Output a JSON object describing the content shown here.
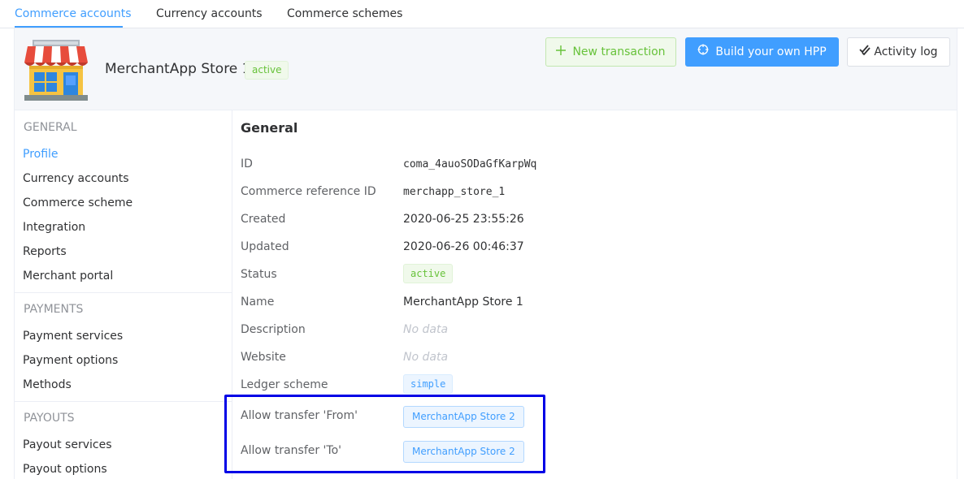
{
  "tabs": [
    {
      "label": "Commerce accounts",
      "active": true
    },
    {
      "label": "Currency accounts",
      "active": false
    },
    {
      "label": "Commerce schemes",
      "active": false
    }
  ],
  "header": {
    "logo_icon": "store-icon",
    "merchant_name": "MerchantApp Store 1",
    "status_tag": "active",
    "buttons": {
      "new_transaction": "New transaction",
      "build_hpp": "Build your own HPP",
      "activity_log": "Activity log"
    }
  },
  "sidebar": {
    "general_title": "GENERAL",
    "general_items": [
      "Profile",
      "Currency accounts",
      "Commerce scheme",
      "Integration",
      "Reports",
      "Merchant portal"
    ],
    "payments_title": "PAYMENTS",
    "payments_items": [
      "Payment services",
      "Payment options",
      "Methods"
    ],
    "payouts_title": "PAYOUTS",
    "payouts_items": [
      "Payout services",
      "Payout options"
    ],
    "active_item": "Profile"
  },
  "main": {
    "title": "General",
    "fields": {
      "id": {
        "label": "ID",
        "value": "coma_4auoSODaGfKarpWq"
      },
      "ref_id": {
        "label": "Commerce reference ID",
        "value": "merchapp_store_1"
      },
      "created": {
        "label": "Created",
        "value": "2020-06-25 23:55:26"
      },
      "updated": {
        "label": "Updated",
        "value": "2020-06-26 00:46:37"
      },
      "status": {
        "label": "Status",
        "value": "active"
      },
      "name": {
        "label": "Name",
        "value": "MerchantApp Store 1"
      },
      "description": {
        "label": "Description",
        "value": "No data"
      },
      "website": {
        "label": "Website",
        "value": "No data"
      },
      "ledger": {
        "label": "Ledger scheme",
        "value": "simple"
      },
      "transfer_from": {
        "label": "Allow transfer 'From'",
        "value": "MerchantApp Store 2"
      },
      "transfer_to": {
        "label": "Allow transfer 'To'",
        "value": "MerchantApp Store 2"
      }
    }
  },
  "colors": {
    "accent": "#409eff",
    "success": "#67c23a",
    "highlight_box": "#0000e6"
  }
}
